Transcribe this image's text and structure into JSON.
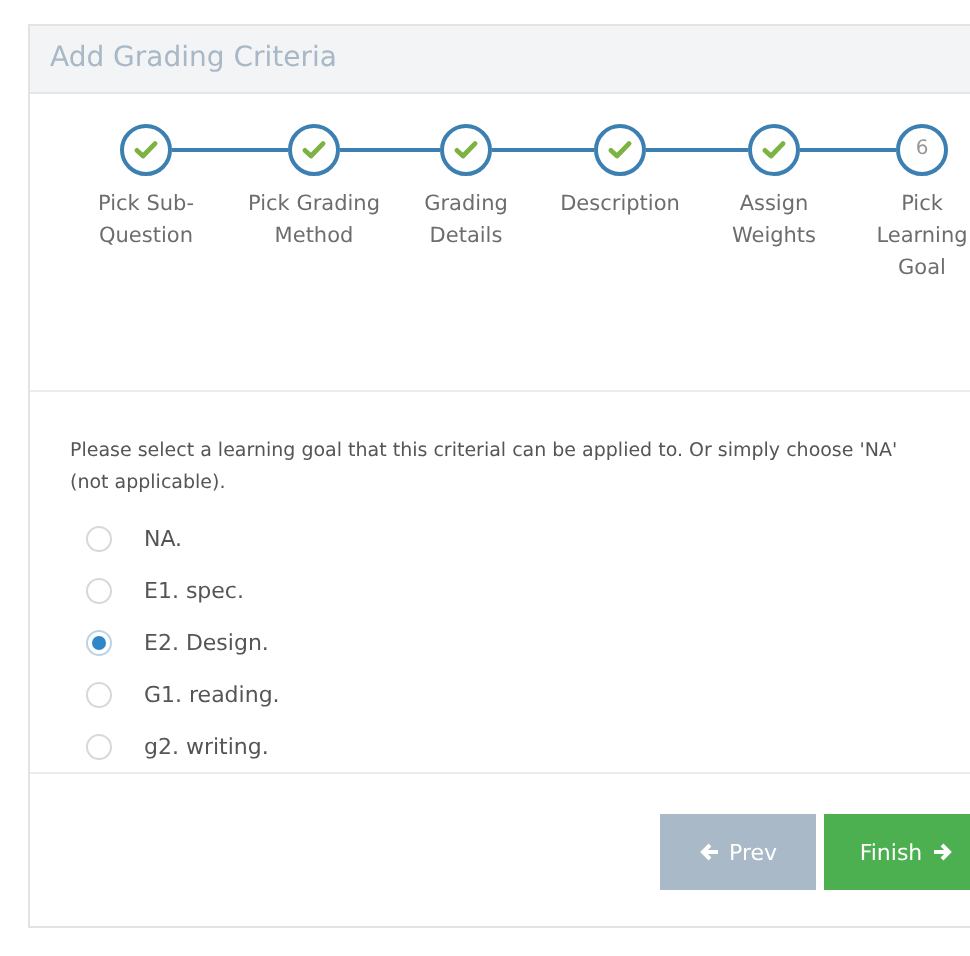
{
  "panel": {
    "title": "Add Grading Criteria"
  },
  "steps": [
    {
      "label": "Pick Sub-Question",
      "done": true
    },
    {
      "label": "Pick Grading Method",
      "done": true
    },
    {
      "label": "Grading Details",
      "done": true
    },
    {
      "label": "Description",
      "done": true
    },
    {
      "label": "Assign Weights",
      "done": true
    },
    {
      "label": "Pick Learning Goal",
      "done": false,
      "number": "6"
    }
  ],
  "prompt": "Please select a learning goal that this criterial can be applied to. Or simply choose 'NA' (not applicable).",
  "options": [
    {
      "label": "NA.",
      "selected": false
    },
    {
      "label": "E1. spec.",
      "selected": false
    },
    {
      "label": "E2. Design.",
      "selected": true
    },
    {
      "label": "G1. reading.",
      "selected": false
    },
    {
      "label": "g2. writing.",
      "selected": false
    }
  ],
  "buttons": [
    {
      "kind": "prev",
      "label": "Prev",
      "disabled": true
    },
    {
      "kind": "next",
      "label": "Finish",
      "disabled": false
    }
  ]
}
